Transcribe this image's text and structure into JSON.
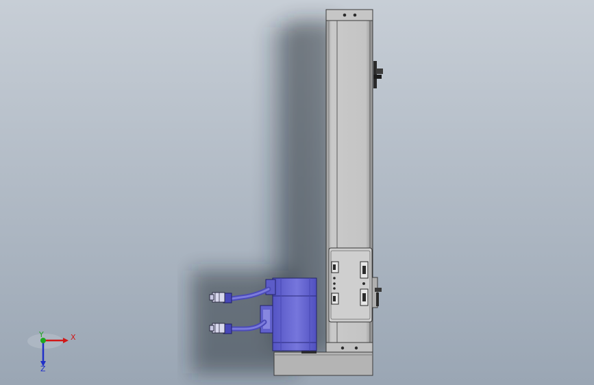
{
  "viewport": {
    "background_top": "#c7ced6",
    "background_bottom": "#9aa6b4"
  },
  "triad": {
    "x_label": "X",
    "y_label": "Y",
    "z_label": "Z",
    "x_color": "#d01818",
    "y_color": "#1fa81f",
    "z_color": "#2030c8"
  },
  "colors": {
    "rail_body": "#b9b9b9",
    "rail_light": "#d2d2d2",
    "rail_edge": "#4a4a4a",
    "motor": "#6b6bd6",
    "motor_dark": "#3e3ea6",
    "motor_light": "#8c8ce8",
    "connector": "#dcdcf2",
    "bracket": "#a6a6aa",
    "shadow": "#000000"
  }
}
